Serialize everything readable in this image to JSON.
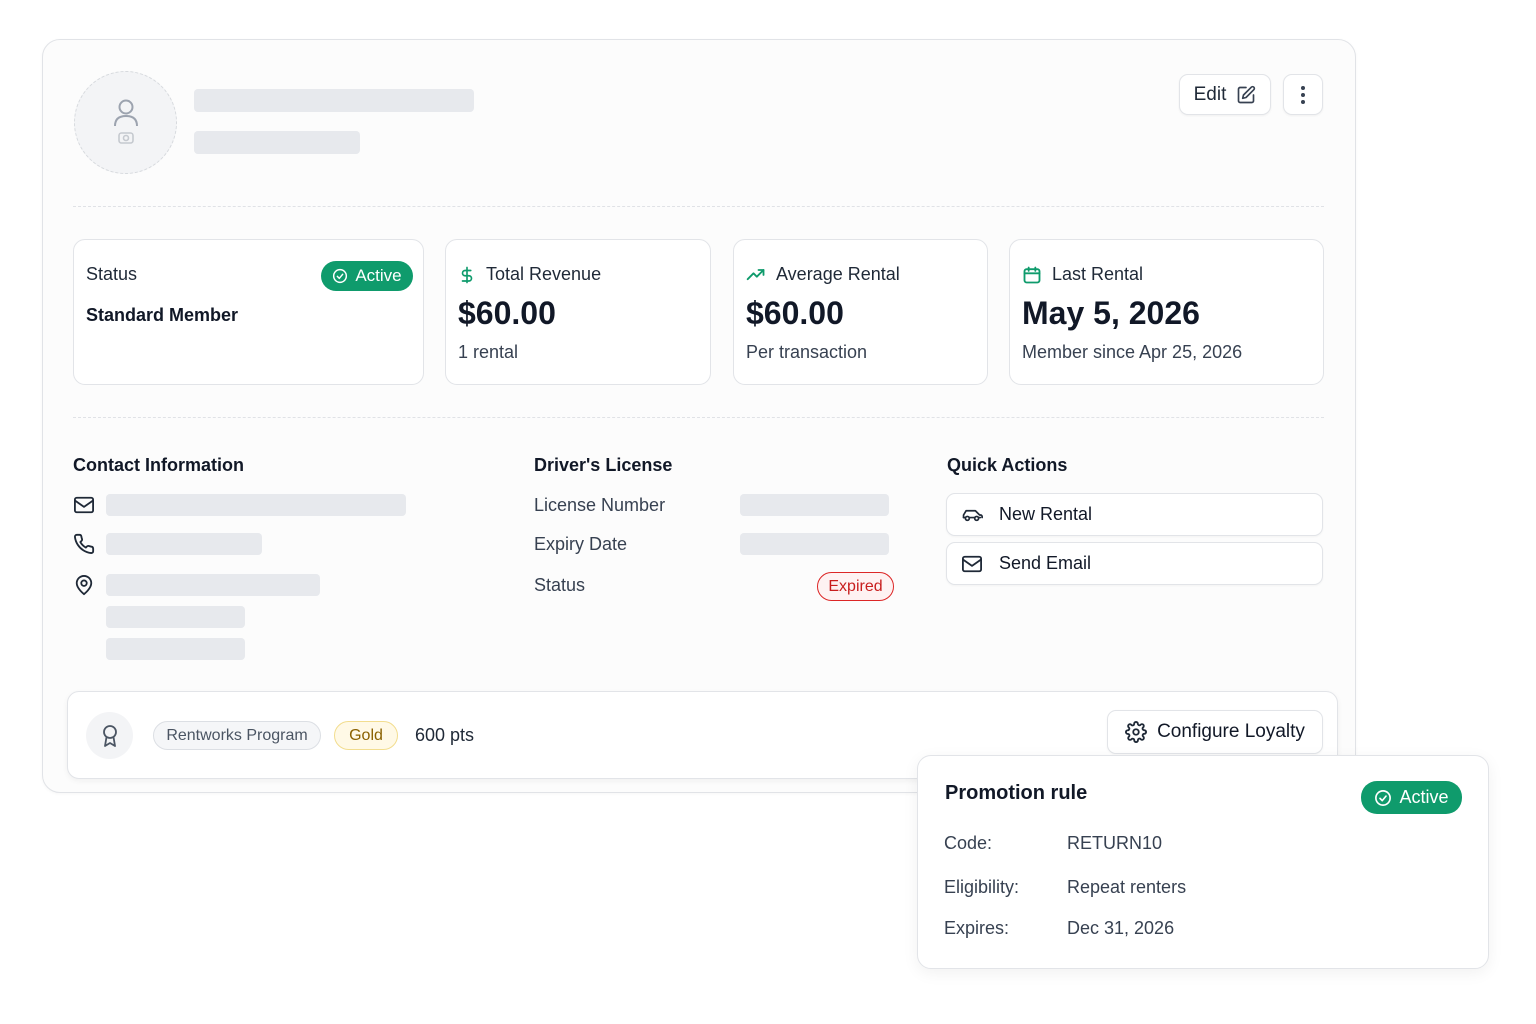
{
  "header": {
    "edit_label": "Edit"
  },
  "stats": {
    "status": {
      "label": "Status",
      "badge": "Active",
      "value": "Standard Member"
    },
    "revenue": {
      "label": "Total Revenue",
      "value": "$60.00",
      "sub": "1 rental"
    },
    "average": {
      "label": "Average Rental",
      "value": "$60.00",
      "sub": "Per transaction"
    },
    "last": {
      "label": "Last Rental",
      "value": "May 5, 2026",
      "sub": "Member since Apr 25, 2026"
    }
  },
  "contact": {
    "title": "Contact Information"
  },
  "license": {
    "title": "Driver's License",
    "number_label": "License Number",
    "expiry_label": "Expiry Date",
    "status_label": "Status",
    "status_badge": "Expired"
  },
  "quick_actions": {
    "title": "Quick Actions",
    "new_rental": "New Rental",
    "send_email": "Send Email"
  },
  "loyalty": {
    "program": "Rentworks Program",
    "tier": "Gold",
    "points": "600 pts",
    "configure_label": "Configure Loyalty"
  },
  "promotion": {
    "title": "Promotion rule",
    "badge": "Active",
    "code_label": "Code:",
    "code_value": "RETURN10",
    "eligibility_label": "Eligibility:",
    "eligibility_value": "Repeat renters",
    "expires_label": "Expires:",
    "expires_value": "Dec 31, 2026"
  },
  "colors": {
    "accent_green": "#0f9b6c",
    "expired_red": "#dc2626",
    "gold_text": "#8a6100",
    "skeleton": "#e7e9ed"
  }
}
